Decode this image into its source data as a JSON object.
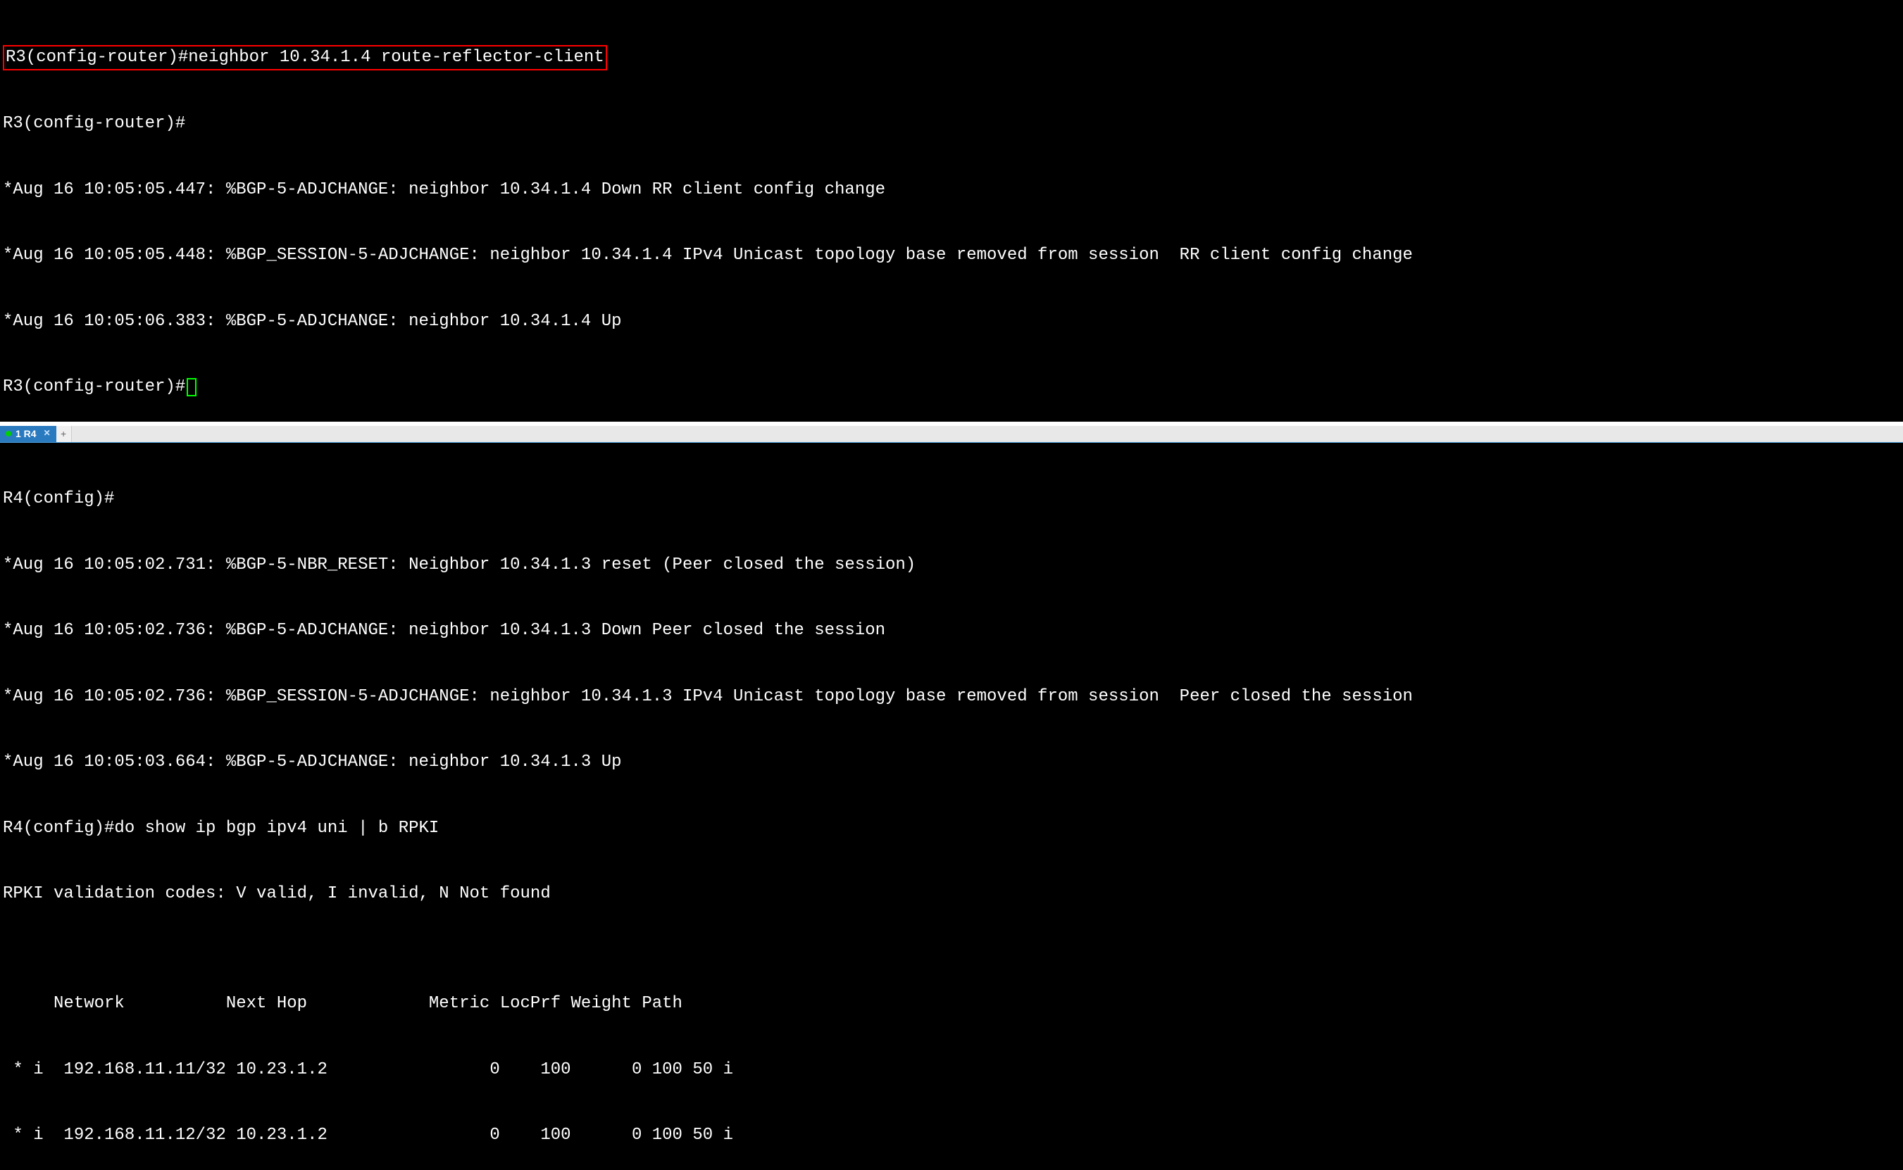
{
  "pane1": {
    "highlighted_cmd": "R3(config-router)#neighbor 10.34.1.4 route-reflector-client",
    "lines": [
      "R3(config-router)#",
      "*Aug 16 10:05:05.447: %BGP-5-ADJCHANGE: neighbor 10.34.1.4 Down RR client config change",
      "*Aug 16 10:05:05.448: %BGP_SESSION-5-ADJCHANGE: neighbor 10.34.1.4 IPv4 Unicast topology base removed from session  RR client config change",
      "*Aug 16 10:05:06.383: %BGP-5-ADJCHANGE: neighbor 10.34.1.4 Up"
    ],
    "prompt_with_cursor": "R3(config-router)#"
  },
  "tab": {
    "label": "1 R4"
  },
  "pane2": {
    "lines": [
      "R4(config)#",
      "*Aug 16 10:05:02.731: %BGP-5-NBR_RESET: Neighbor 10.34.1.3 reset (Peer closed the session)",
      "*Aug 16 10:05:02.736: %BGP-5-ADJCHANGE: neighbor 10.34.1.3 Down Peer closed the session",
      "*Aug 16 10:05:02.736: %BGP_SESSION-5-ADJCHANGE: neighbor 10.34.1.3 IPv4 Unicast topology base removed from session  Peer closed the session",
      "*Aug 16 10:05:03.664: %BGP-5-ADJCHANGE: neighbor 10.34.1.3 Up",
      "R4(config)#do show ip bgp ipv4 uni | b RPKI",
      "RPKI validation codes: V valid, I invalid, N Not found",
      "",
      "     Network          Next Hop            Metric LocPrf Weight Path",
      " * i  192.168.11.11/32 10.23.1.2                0    100      0 100 50 i",
      " * i  192.168.11.12/32 10.23.1.2                0    100      0 100 50 i"
    ]
  }
}
